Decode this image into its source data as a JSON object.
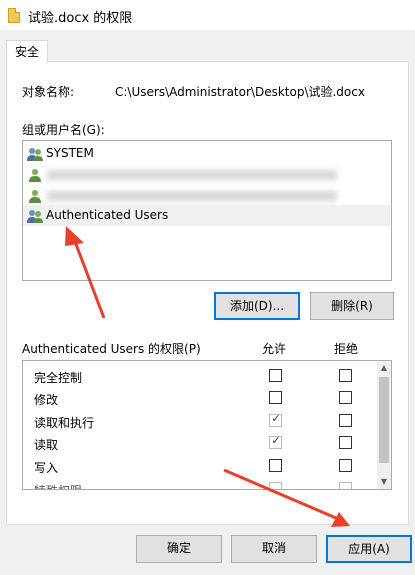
{
  "window": {
    "title": "试验.docx 的权限"
  },
  "tabs": [
    {
      "label": "安全"
    }
  ],
  "object": {
    "label": "对象名称:",
    "path": "C:\\Users\\Administrator\\Desktop\\试验.docx"
  },
  "groups": {
    "label": "组或用户名(G):",
    "users": [
      {
        "name": "SYSTEM"
      },
      {
        "name": ""
      },
      {
        "name": ""
      },
      {
        "name": "Authenticated Users",
        "selected": true
      }
    ],
    "add_button": "添加(D)...",
    "remove_button": "删除(R)"
  },
  "permissions": {
    "header": "Authenticated Users 的权限(P)",
    "allow_header": "允许",
    "deny_header": "拒绝",
    "rows": [
      {
        "name": "完全控制",
        "allow": false,
        "deny": false
      },
      {
        "name": "修改",
        "allow": false,
        "deny": false
      },
      {
        "name": "读取和执行",
        "allow": true,
        "deny": false
      },
      {
        "name": "读取",
        "allow": true,
        "deny": false
      },
      {
        "name": "写入",
        "allow": false,
        "deny": false
      },
      {
        "name": "特殊权限",
        "allow": false,
        "deny": false
      }
    ]
  },
  "footer": {
    "ok": "确定",
    "cancel": "取消",
    "apply": "应用(A)"
  },
  "annotation_color": "#e8402a"
}
